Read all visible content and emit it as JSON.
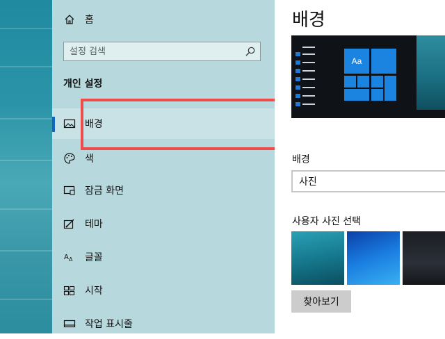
{
  "nav": {
    "home_label": "홈",
    "search_placeholder": "설정 검색",
    "section_title": "개인 설정",
    "items": [
      {
        "label": "배경",
        "icon": "picture-icon",
        "selected": true
      },
      {
        "label": "색",
        "icon": "palette-icon"
      },
      {
        "label": "잠금 화면",
        "icon": "lock-screen-icon"
      },
      {
        "label": "테마",
        "icon": "brush-icon"
      },
      {
        "label": "글꼴",
        "icon": "font-icon"
      },
      {
        "label": "시작",
        "icon": "start-icon"
      },
      {
        "label": "작업 표시줄",
        "icon": "taskbar-icon"
      }
    ]
  },
  "main": {
    "title": "배경",
    "preview_tile_label": "Aa",
    "background_label": "배경",
    "background_value": "사진",
    "choose_picture_label": "사용자 사진 선택",
    "browse_label": "찾아보기"
  },
  "colors": {
    "accent": "#1565c0",
    "nav_bg": "#b7d8dc",
    "highlight": "#ef4b4b"
  }
}
